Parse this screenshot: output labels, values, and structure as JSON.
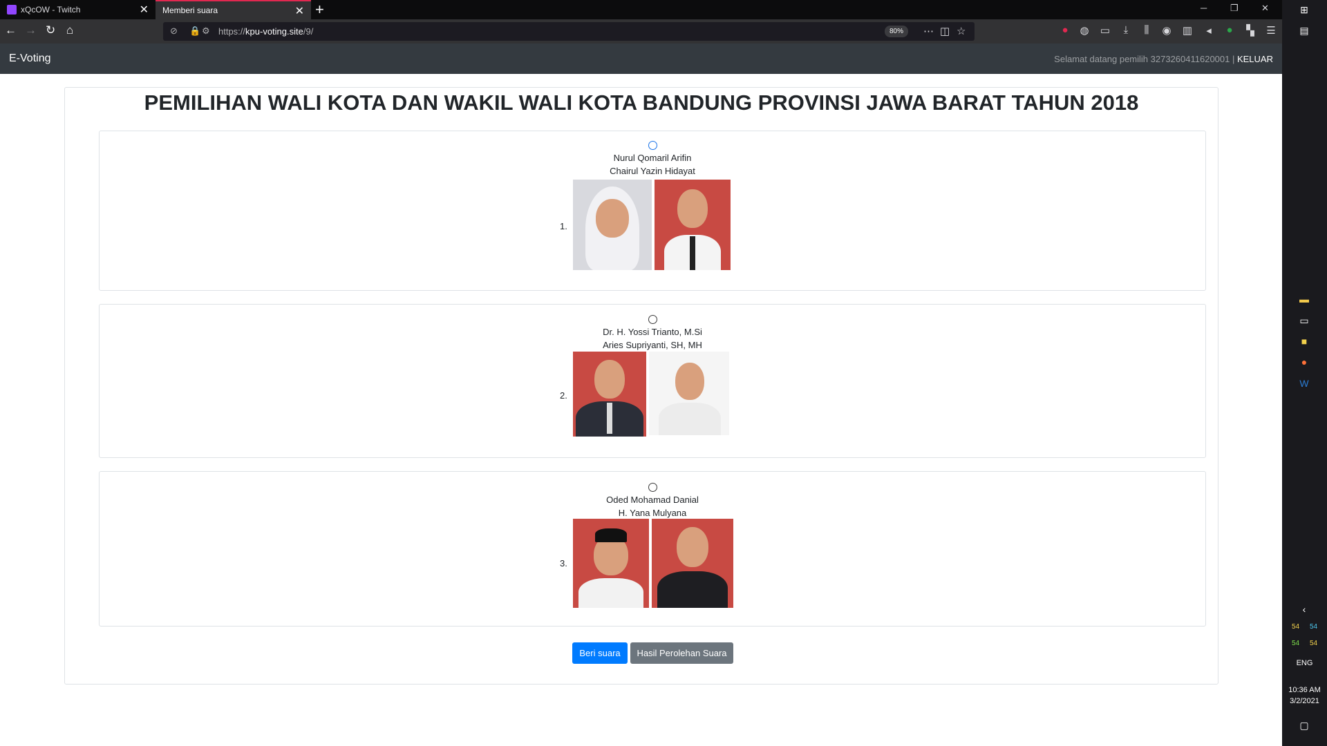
{
  "browser": {
    "tabs": [
      {
        "label": "xQcOW - Twitch",
        "active": false
      },
      {
        "label": "Memberi suara",
        "active": true
      }
    ],
    "url_scheme": "https://",
    "url_host": "kpu-voting.site",
    "url_path": "/9/",
    "zoom": "80%"
  },
  "app": {
    "brand": "E-Voting",
    "welcome_prefix": "Selamat datang pemilih 3273260411620001 | ",
    "logout_label": "KELUAR"
  },
  "main": {
    "title": "PEMILIHAN WALI KOTA DAN WAKIL WALI KOTA BANDUNG PROVINSI JAWA BARAT TAHUN 2018",
    "candidates": [
      {
        "number": "1.",
        "name1": "Nurul Qomaril Arifin",
        "name2": "Chairul Yazin Hidayat"
      },
      {
        "number": "2.",
        "name1": "Dr. H. Yossi Trianto, M.Si",
        "name2": "Aries Supriyanti, SH, MH"
      },
      {
        "number": "3.",
        "name1": "Oded Mohamad Danial",
        "name2": "H. Yana Mulyana"
      }
    ],
    "vote_button": "Beri suara",
    "results_button": "Hasil Perolehan Suara"
  },
  "taskbar": {
    "tray_numbers": [
      "54",
      "54",
      "54",
      "54"
    ],
    "language": "ENG",
    "time": "10:36 AM",
    "date": "3/2/2021"
  },
  "colors": {
    "primary": "#007bff",
    "secondary": "#6c757d",
    "navbar": "#343a40",
    "photo_red": "#c84a43"
  }
}
